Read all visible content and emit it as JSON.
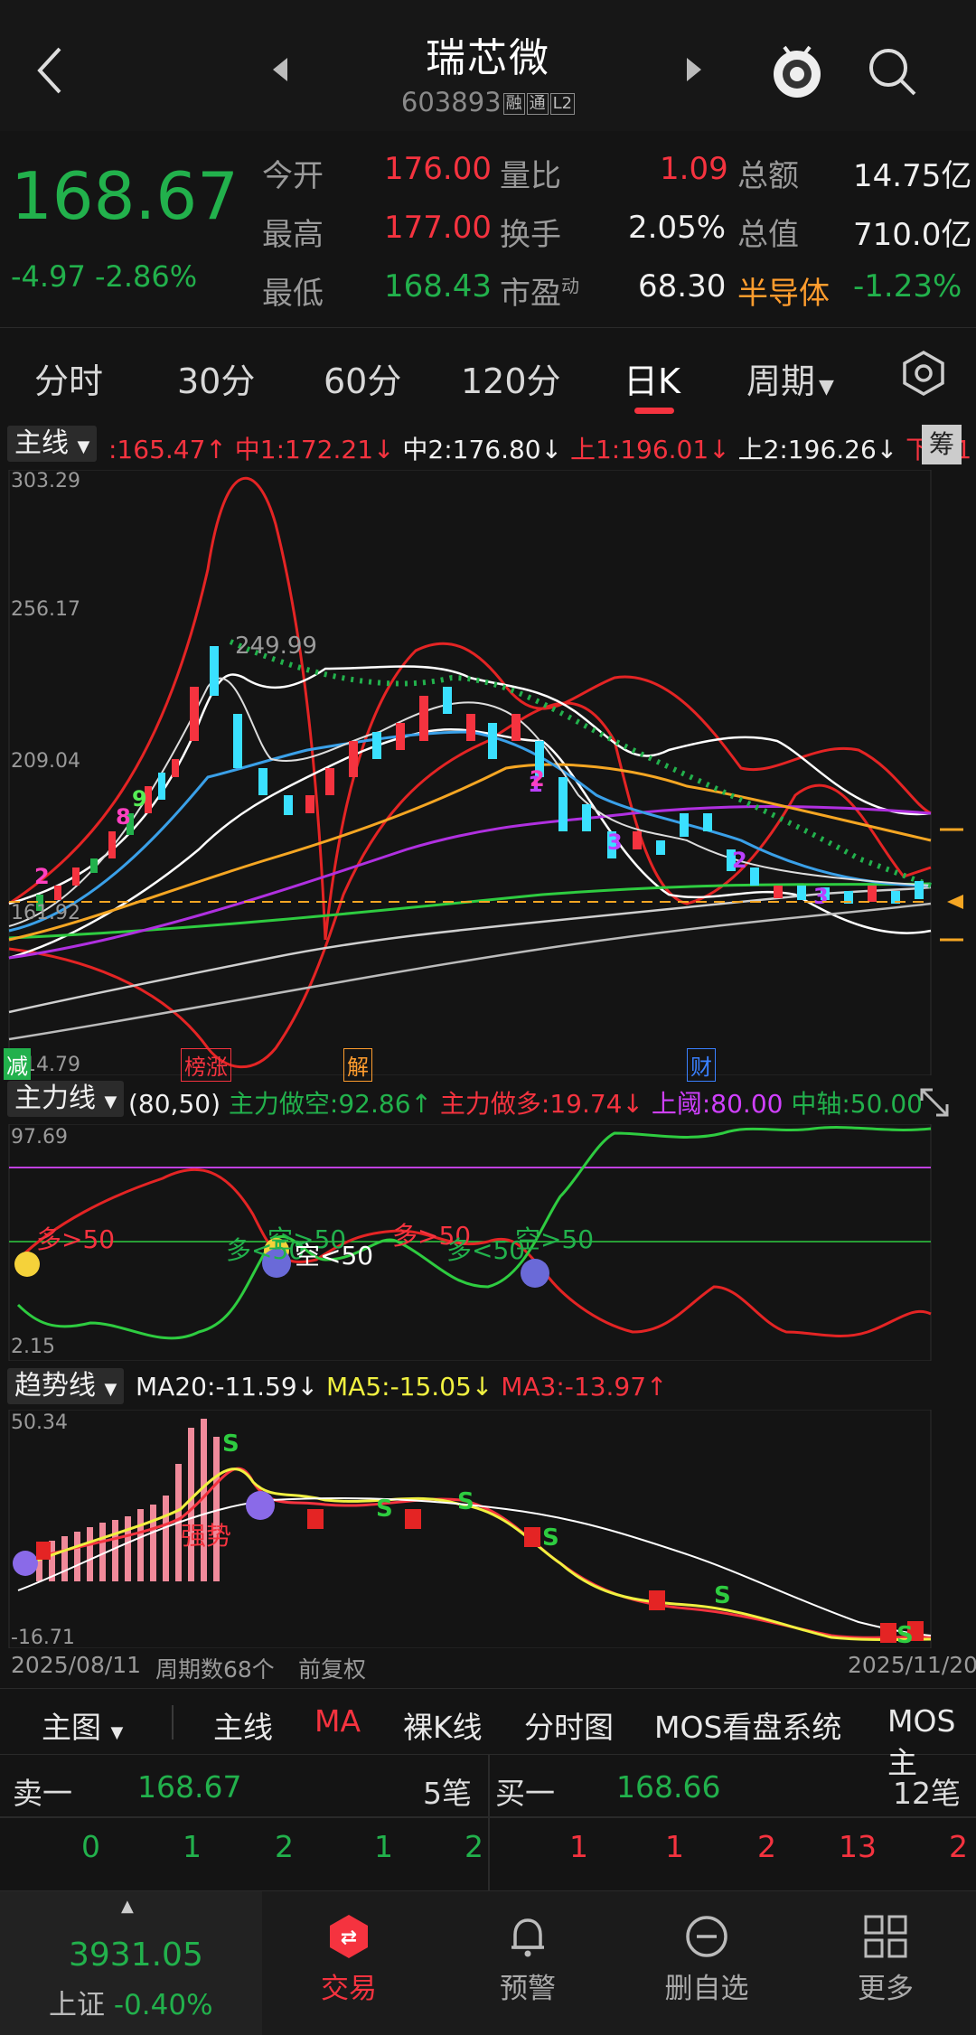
{
  "header": {
    "title": "瑞芯微",
    "code": "603893",
    "badges": [
      "融",
      "通",
      "L2"
    ]
  },
  "quote": {
    "price": "168.67",
    "change": "-4.97",
    "change_pct": "-2.86%",
    "open_label": "今开",
    "open": "176.00",
    "high_label": "最高",
    "high": "177.00",
    "low_label": "最低",
    "low": "168.43",
    "vol_ratio_label": "量比",
    "vol_ratio": "1.09",
    "turnover_label": "换手",
    "turnover": "2.05%",
    "pe_label": "市盈",
    "pe_sup": "动",
    "pe": "68.30",
    "amount_label": "总额",
    "amount": "14.75亿",
    "mktcap_label": "总值",
    "mktcap": "710.0亿",
    "sector": "半导体",
    "sector_pct": "-1.23%"
  },
  "tabs": [
    "分时",
    "30分",
    "60分",
    "120分",
    "日K",
    "周期"
  ],
  "main_chart": {
    "selector": "主线",
    "values": [
      ":165.47↑",
      "中1:172.21↓",
      "中2:176.80↓",
      "上1:196.01↓",
      "上2:196.26↓",
      "下1:1"
    ],
    "chip_label": "筹",
    "y_labels": [
      "303.29",
      "256.17",
      "209.04",
      "161.92",
      "114.79"
    ],
    "peak_label": "249.99",
    "event_tags": [
      "减",
      "榜涨",
      "解",
      "财"
    ]
  },
  "mf_chart": {
    "selector": "主力线",
    "params": "(80,50)",
    "values": [
      "主力做空:92.86↑",
      "主力做多:19.74↓",
      "上阈:80.00",
      "中轴:50.00"
    ],
    "y_top": "97.69",
    "y_bottom": "2.15",
    "annotations": [
      "多>50",
      "多<50",
      "空>50",
      "空<50",
      "多>50",
      "多<50",
      "空>50"
    ]
  },
  "trend_chart": {
    "selector": "趋势线",
    "values": [
      "MA20:-11.59↓",
      "MA5:-15.05↓",
      "MA3:-13.97↑"
    ],
    "y_top": "50.34",
    "y_bottom": "-16.71",
    "annotation": "强势"
  },
  "footer_axis": {
    "start": "2025/08/11",
    "period": "周期数68个",
    "adjust": "前复权",
    "end": "2025/11/20"
  },
  "subtabs": [
    "主图",
    "主线",
    "MA",
    "裸K线",
    "分时图",
    "MOS看盘系统",
    "MOS主"
  ],
  "orderbook": {
    "sell_label": "卖一",
    "sell_price": "168.67",
    "sell_count": "5笔",
    "buy_label": "买一",
    "buy_price": "168.66",
    "buy_count": "12笔",
    "sell_queue": [
      "0",
      "1",
      "2",
      "1",
      "2"
    ],
    "buy_queue": [
      "1",
      "1",
      "2",
      "13",
      "2"
    ]
  },
  "nav": {
    "index_value": "3931.05",
    "index_name": "上证",
    "index_pct": "-0.40%",
    "items": [
      "交易",
      "预警",
      "删自选",
      "更多"
    ]
  },
  "colors": {
    "up": "#f5333f",
    "down": "#22b14c",
    "accent": "#f5333f",
    "bg": "#141414"
  }
}
